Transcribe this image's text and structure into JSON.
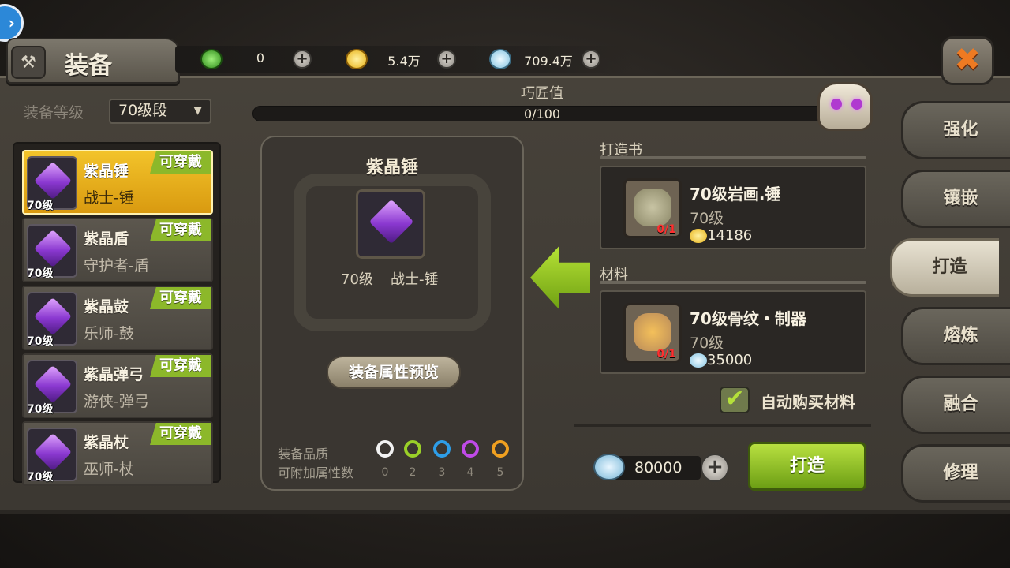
{
  "header": {
    "title": "装备",
    "currencies": [
      {
        "name": "energy",
        "icon": "green-potion-icon",
        "value": "0"
      },
      {
        "name": "gold",
        "icon": "gold-icon",
        "value": "5.4万"
      },
      {
        "name": "shell",
        "icon": "shell-icon",
        "value": "709.4万"
      }
    ],
    "close_icon": "✖"
  },
  "filter": {
    "label": "装备等级",
    "selected": "70级段",
    "arrow": "▼"
  },
  "equipment_list": [
    {
      "name": "紫晶锤",
      "class": "战士-锤",
      "level": "70级",
      "badge": "可穿戴",
      "selected": true
    },
    {
      "name": "紫晶盾",
      "class": "守护者-盾",
      "level": "70级",
      "badge": "可穿戴",
      "selected": false
    },
    {
      "name": "紫晶鼓",
      "class": "乐师-鼓",
      "level": "70级",
      "badge": "可穿戴",
      "selected": false
    },
    {
      "name": "紫晶弹弓",
      "class": "游侠-弹弓",
      "level": "70级",
      "badge": "可穿戴",
      "selected": false
    },
    {
      "name": "紫晶杖",
      "class": "巫师-杖",
      "level": "70级",
      "badge": "可穿戴",
      "selected": false
    }
  ],
  "craftsman": {
    "label": "巧匠值",
    "value": "0/100",
    "progress": 0
  },
  "detail": {
    "name": "紫晶锤",
    "level": "70级",
    "class": "战士-锤",
    "preview_button": "装备属性预览",
    "quality_label": "装备品质",
    "attr_label": "可附加属性数",
    "qualities": [
      {
        "color": "#f2f2f2",
        "count": "0"
      },
      {
        "color": "#9ad028",
        "count": "2"
      },
      {
        "color": "#2e9ee8",
        "count": "3"
      },
      {
        "color": "#c04ae8",
        "count": "4"
      },
      {
        "color": "#f0a020",
        "count": "5"
      }
    ]
  },
  "forge_book": {
    "label": "打造书",
    "name": "70级岩画.锤",
    "level": "70级",
    "count": "0/1",
    "cost": "14186",
    "cost_icon": "gold-icon"
  },
  "material": {
    "label": "材料",
    "name": "70级骨纹・制器",
    "level": "70级",
    "count": "0/1",
    "cost": "35000",
    "cost_icon": "shell-icon"
  },
  "auto_buy": {
    "label": "自动购买材料",
    "checked": true,
    "check_glyph": "✔"
  },
  "forge_cost": {
    "value": "80000",
    "icon": "shell-icon",
    "plus": "+"
  },
  "forge_button": "打造",
  "side_tabs": [
    {
      "label": "强化",
      "active": false
    },
    {
      "label": "镶嵌",
      "active": false
    },
    {
      "label": "打造",
      "active": true
    },
    {
      "label": "熔炼",
      "active": false
    },
    {
      "label": "融合",
      "active": false
    },
    {
      "label": "修理",
      "active": false
    }
  ],
  "side_bubble": "›"
}
